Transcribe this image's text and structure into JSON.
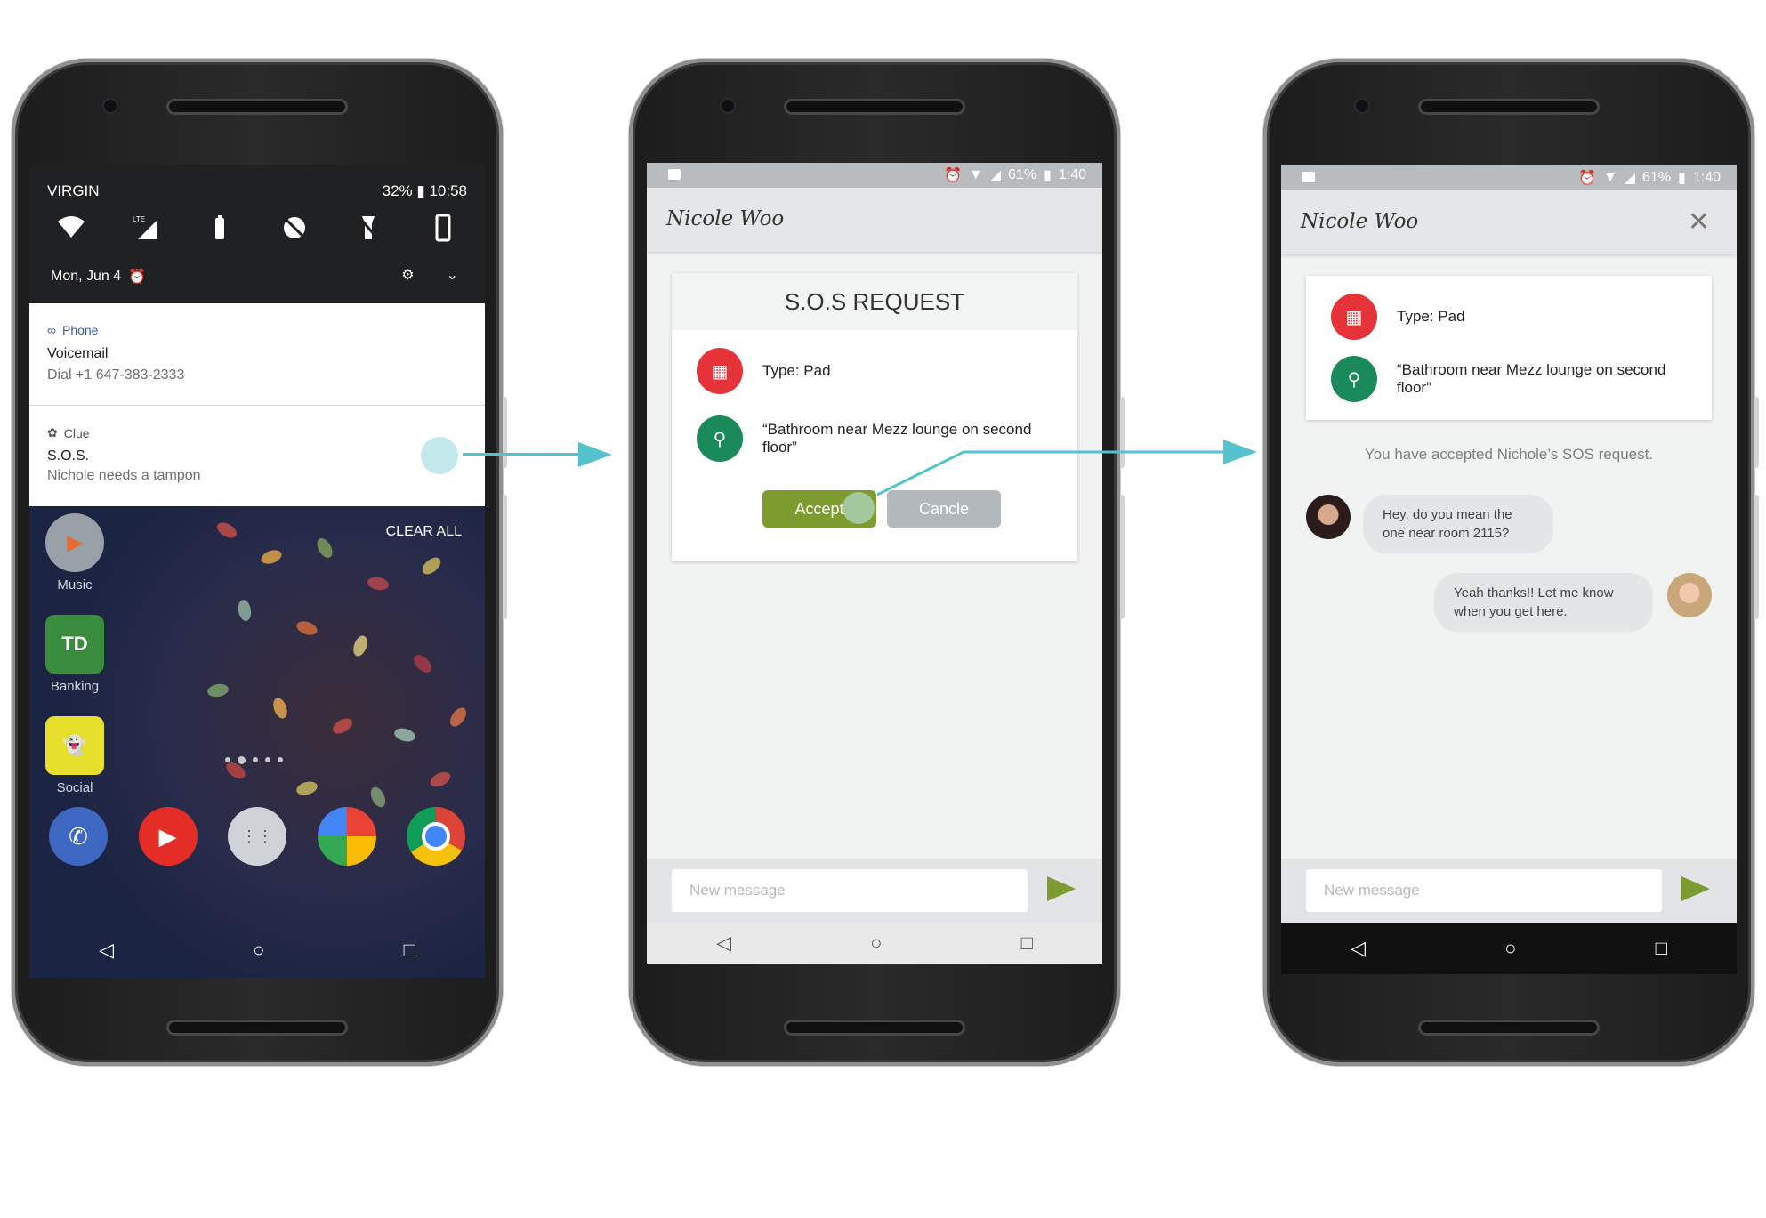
{
  "phone1": {
    "carrier": "VIRGIN",
    "battery": "32%",
    "time": "10:58",
    "date": "Mon, Jun 4",
    "notifications": [
      {
        "app": "Phone",
        "title": "Voicemail",
        "text": "Dial +1 647-383-2333"
      },
      {
        "app": "Clue",
        "title": "S.O.S.",
        "text": "Nichole needs a tampon"
      }
    ],
    "clear_all": "CLEAR ALL",
    "apps": [
      {
        "label": "Music",
        "icon": "play-music-icon"
      },
      {
        "label": "Banking",
        "icon": "td-bank-icon"
      },
      {
        "label": "Social",
        "icon": "snapchat-icon"
      }
    ],
    "dock": [
      "phone-icon",
      "youtube-icon",
      "app-drawer-icon",
      "photos-icon",
      "chrome-icon"
    ]
  },
  "phone2": {
    "status": {
      "battery": "61%",
      "time": "1:40"
    },
    "contact": "Nicole Woo",
    "card_title": "S.O.S REQUEST",
    "type_label": "Type: Pad",
    "location": "“Bathroom near Mezz lounge on second floor”",
    "accept": "Accept",
    "cancel": "Cancle",
    "compose_placeholder": "New message"
  },
  "phone3": {
    "status": {
      "battery": "61%",
      "time": "1:40"
    },
    "contact": "Nicole Woo",
    "type_label": "Type: Pad",
    "location": "“Bathroom near Mezz lounge on second floor”",
    "accepted_text": "You have accepted Nichole’s SOS request.",
    "messages": [
      {
        "from": "other",
        "text": "Hey, do you mean the one near room 2115?"
      },
      {
        "from": "self",
        "text": "Yeah thanks!! Let me know when you get here."
      }
    ],
    "compose_placeholder": "New message"
  },
  "colors": {
    "accent": "#56c2cc",
    "accept": "#7d9b2e",
    "sos_red": "#e53339",
    "location_green": "#1b8a5a"
  }
}
